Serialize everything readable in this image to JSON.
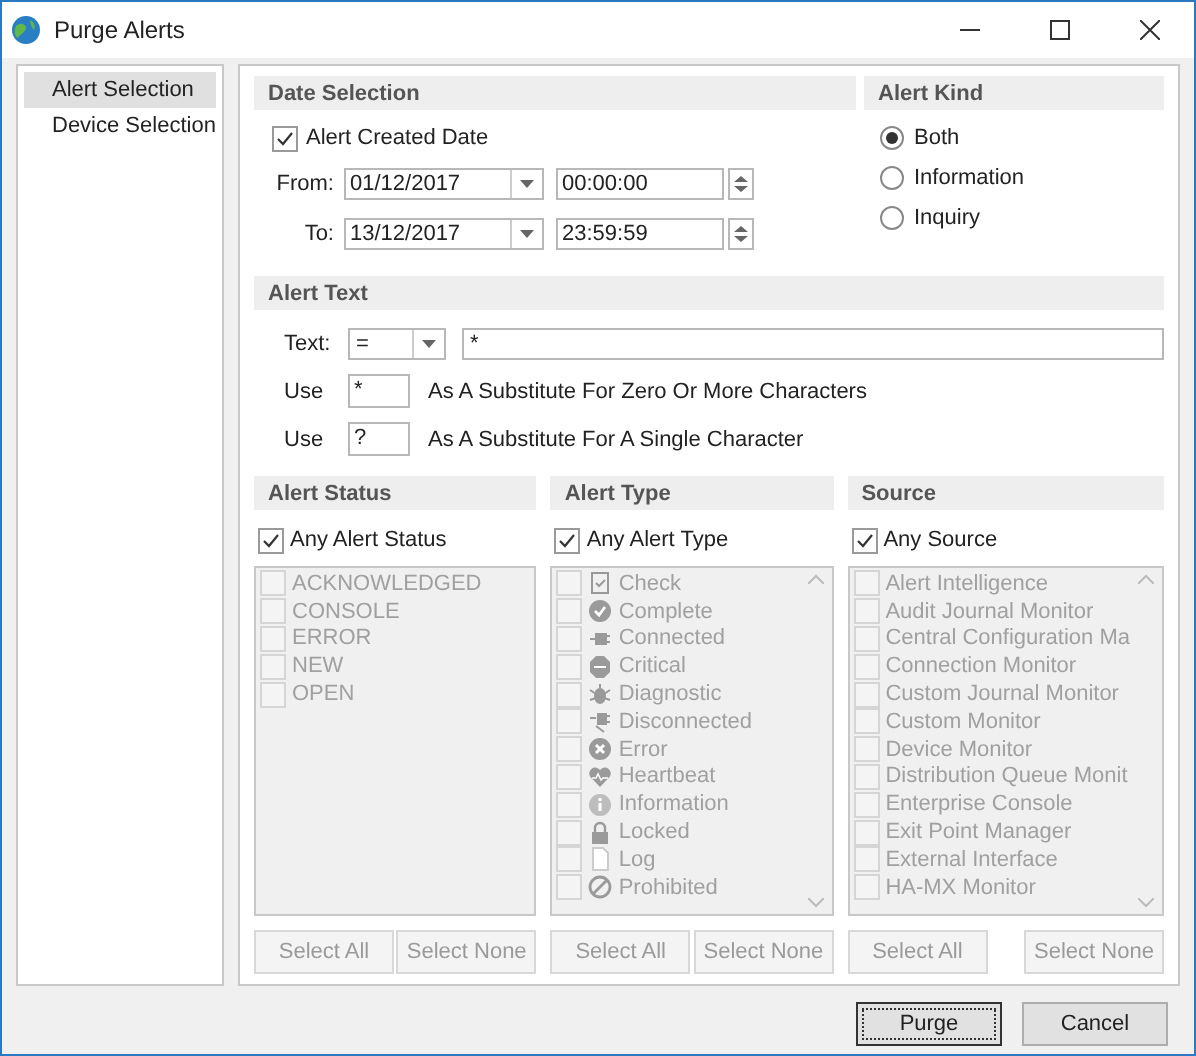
{
  "window": {
    "title": "Purge Alerts"
  },
  "sidebar": {
    "items": [
      {
        "label": "Alert Selection",
        "selected": true
      },
      {
        "label": "Device Selection",
        "selected": false
      }
    ]
  },
  "date_selection": {
    "title": "Date Selection",
    "alert_created_date": {
      "label": "Alert Created Date",
      "checked": true
    },
    "ranges": [
      {
        "label": "From:",
        "date": "01/12/2017",
        "time": "00:00:00"
      },
      {
        "label": "To:",
        "date": "13/12/2017",
        "time": "23:59:59"
      }
    ]
  },
  "alert_kind": {
    "title": "Alert Kind",
    "options": [
      {
        "label": "Both",
        "selected": true
      },
      {
        "label": "Information",
        "selected": false
      },
      {
        "label": "Inquiry",
        "selected": false
      }
    ]
  },
  "alert_text": {
    "title": "Alert Text",
    "text_label": "Text:",
    "operator": "=",
    "value": "*",
    "wildcards": [
      {
        "label": "Use",
        "value": "*",
        "description": "As A Substitute For Zero Or More Characters"
      },
      {
        "label": "Use",
        "value": "?",
        "description": "As A Substitute For A Single Character"
      }
    ]
  },
  "lists": [
    {
      "title": "Alert Status",
      "any": {
        "label": "Any Alert Status",
        "checked": true
      },
      "scrollbar": false,
      "items": [
        {
          "label": "ACKNOWLEDGED",
          "checked": false,
          "disabled": true
        },
        {
          "label": "CONSOLE",
          "checked": false,
          "disabled": true
        },
        {
          "label": "ERROR",
          "checked": false,
          "disabled": true
        },
        {
          "label": "NEW",
          "checked": false,
          "disabled": true
        },
        {
          "label": "OPEN",
          "checked": false,
          "disabled": true
        }
      ],
      "buttons": [
        {
          "label": "Select All",
          "disabled": true
        },
        {
          "label": "Select None",
          "disabled": true
        }
      ]
    },
    {
      "title": "Alert Type",
      "any": {
        "label": "Any Alert Type",
        "checked": true
      },
      "scrollbar": true,
      "items": [
        {
          "label": "Check",
          "checked": false,
          "disabled": true
        },
        {
          "label": "Complete",
          "checked": false,
          "disabled": true
        },
        {
          "label": "Connected",
          "checked": false,
          "disabled": true
        },
        {
          "label": "Critical",
          "checked": false,
          "disabled": true
        },
        {
          "label": "Diagnostic",
          "checked": false,
          "disabled": true
        },
        {
          "label": "Disconnected",
          "checked": false,
          "disabled": true
        },
        {
          "label": "Error",
          "checked": false,
          "disabled": true
        },
        {
          "label": "Heartbeat",
          "checked": false,
          "disabled": true
        },
        {
          "label": "Information",
          "checked": false,
          "disabled": true
        },
        {
          "label": "Locked",
          "checked": false,
          "disabled": true
        },
        {
          "label": "Log",
          "checked": false,
          "disabled": true
        },
        {
          "label": "Prohibited",
          "checked": false,
          "disabled": true
        }
      ],
      "buttons": [
        {
          "label": "Select All",
          "disabled": true
        },
        {
          "label": "Select None",
          "disabled": true
        }
      ]
    },
    {
      "title": "Source",
      "any": {
        "label": "Any Source",
        "checked": true
      },
      "scrollbar": true,
      "items": [
        {
          "label": "Alert Intelligence",
          "checked": false,
          "disabled": true
        },
        {
          "label": "Audit Journal Monitor",
          "checked": false,
          "disabled": true
        },
        {
          "label": "Central Configuration Ma",
          "checked": false,
          "disabled": true
        },
        {
          "label": "Connection Monitor",
          "checked": false,
          "disabled": true
        },
        {
          "label": "Custom Journal Monitor",
          "checked": false,
          "disabled": true
        },
        {
          "label": "Custom Monitor",
          "checked": false,
          "disabled": true
        },
        {
          "label": "Device Monitor",
          "checked": false,
          "disabled": true
        },
        {
          "label": "Distribution Queue Monit",
          "checked": false,
          "disabled": true
        },
        {
          "label": "Enterprise Console",
          "checked": false,
          "disabled": true
        },
        {
          "label": "Exit Point Manager",
          "checked": false,
          "disabled": true
        },
        {
          "label": "External Interface",
          "checked": false,
          "disabled": true
        },
        {
          "label": "HA-MX Monitor",
          "checked": false,
          "disabled": true
        }
      ],
      "buttons": [
        {
          "label": "Select All",
          "disabled": true
        },
        {
          "label": "Select None",
          "disabled": true
        }
      ]
    }
  ],
  "buttons": [
    {
      "label": "Purge",
      "focused": true
    },
    {
      "label": "Cancel",
      "focused": false
    }
  ]
}
